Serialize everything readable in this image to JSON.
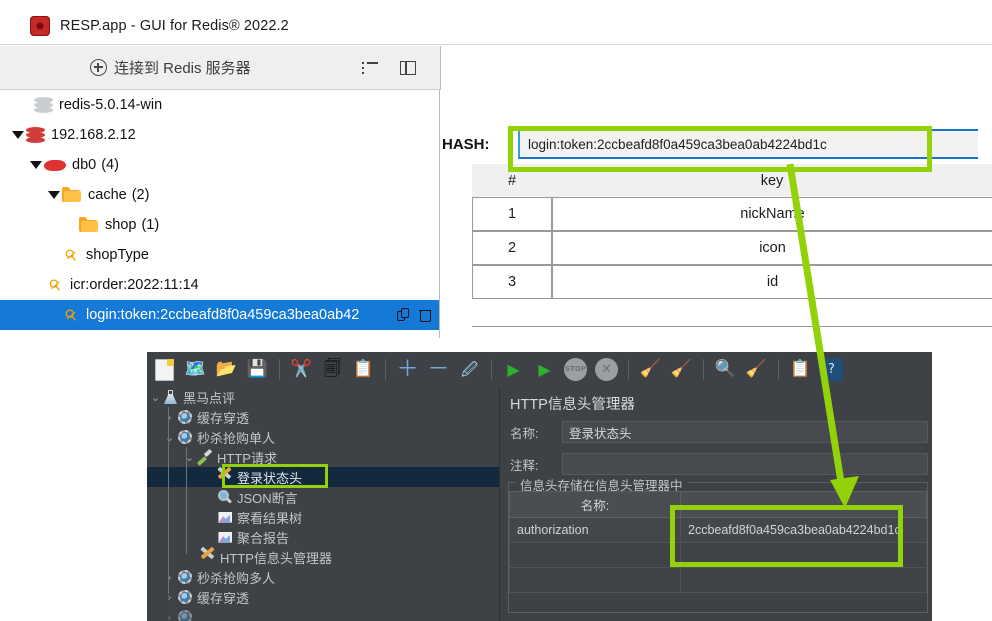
{
  "resp": {
    "title": "RESP.app - GUI for Redis® 2022.2",
    "logo_icon": "redis-hexagon-icon",
    "toolbar": {
      "connect_label": "连接到 Redis 服务器",
      "connect_icon": "plus-circle-icon",
      "list_icon": "list-view-icon",
      "panel_icon": "split-panel-icon"
    },
    "tree": [
      {
        "label": "redis-5.0.14-win",
        "icon": "stacked-disks-grey-icon",
        "indent": 0,
        "caret": "none",
        "count": "",
        "selected": false
      },
      {
        "label": "192.168.2.12",
        "icon": "stacked-disks-red-icon",
        "indent": 0,
        "caret": "down",
        "count": "",
        "selected": false
      },
      {
        "label": "db0",
        "icon": "database-diamond-icon",
        "indent": 1,
        "caret": "down",
        "count": "(4)",
        "selected": false
      },
      {
        "label": "cache",
        "icon": "folder-icon",
        "indent": 2,
        "caret": "down",
        "count": "(2)",
        "selected": false
      },
      {
        "label": "shop",
        "icon": "folder-icon",
        "indent": 3,
        "caret": "none",
        "count": "(1)",
        "selected": false
      },
      {
        "label": "shopType",
        "icon": "key-icon",
        "indent": 3,
        "caret": "none",
        "count": "",
        "selected": false
      },
      {
        "label": "icr:order:2022:11:14",
        "icon": "key-icon",
        "indent": 2,
        "caret": "none",
        "count": "",
        "selected": false
      },
      {
        "label": "login:token:2ccbeafd8f0a459ca3bea0ab42",
        "icon": "key-icon",
        "indent": 3,
        "caret": "none",
        "count": "",
        "selected": true
      }
    ],
    "row_actions": {
      "copy_icon": "copy-icon",
      "delete_icon": "trash-icon"
    },
    "detail": {
      "type_label": "HASH:",
      "key_value": "login:token:2ccbeafd8f0a459ca3bea0ab4224bd1c",
      "columns": [
        "#",
        "key"
      ],
      "rows": [
        {
          "index": "1",
          "key": "nickName"
        },
        {
          "index": "2",
          "key": "icon"
        },
        {
          "index": "3",
          "key": "id"
        }
      ]
    }
  },
  "jmeter": {
    "toolbar_icons": [
      "new-file-icon",
      "templates-icon",
      "open-folder-icon",
      "save-icon",
      "cut-icon",
      "copy-icon",
      "paste-icon",
      "expand-all-icon",
      "collapse-all-icon",
      "toggle-icon",
      "start-icon",
      "start-no-pauses-icon",
      "stop-icon",
      "shutdown-icon",
      "clear-icon",
      "clear-all-icon",
      "search-icon",
      "reset-search-icon",
      "function-helper-icon",
      "help-icon"
    ],
    "tree": [
      {
        "label": "黑马点评",
        "icon": "test-plan-flask-icon",
        "indent": 0,
        "caret": "down",
        "selected": false
      },
      {
        "label": "缓存穿透",
        "icon": "thread-group-gear-icon",
        "indent": 1,
        "caret": "right",
        "selected": false
      },
      {
        "label": "秒杀抢购单人",
        "icon": "thread-group-gear-icon",
        "indent": 1,
        "caret": "down",
        "selected": false
      },
      {
        "label": "HTTP请求",
        "icon": "http-request-pipette-icon",
        "indent": 2,
        "caret": "down",
        "selected": false
      },
      {
        "label": "登录状态头",
        "icon": "header-manager-tools-icon",
        "indent": 3,
        "caret": "none",
        "selected": true
      },
      {
        "label": "JSON断言",
        "icon": "assertion-magnifier-icon",
        "indent": 3,
        "caret": "none",
        "selected": false
      },
      {
        "label": "察看结果树",
        "icon": "listener-chart-icon",
        "indent": 3,
        "caret": "none",
        "selected": false
      },
      {
        "label": "聚合报告",
        "icon": "listener-chart-icon",
        "indent": 3,
        "caret": "none",
        "selected": false
      },
      {
        "label": "HTTP信息头管理器",
        "icon": "header-manager-tools-icon",
        "indent": 2,
        "caret": "none",
        "selected": false
      },
      {
        "label": "秒杀抢购多人",
        "icon": "thread-group-gear-icon",
        "indent": 1,
        "caret": "right",
        "selected": false
      },
      {
        "label": "缓存穿透",
        "icon": "thread-group-gear-icon",
        "indent": 1,
        "caret": "right",
        "selected": false
      }
    ],
    "panel": {
      "heading": "HTTP信息头管理器",
      "name_label": "名称:",
      "name_value": "登录状态头",
      "comment_label": "注释:",
      "comment_value": "",
      "group_legend": "信息头存储在信息头管理器中",
      "table_columns": [
        "名称:",
        ""
      ],
      "table_rows": [
        {
          "name": "authorization",
          "value": "2ccbeafd8f0a459ca3bea0ab4224bd1c"
        }
      ]
    }
  },
  "annotations": {
    "highlight_color": "#93d109",
    "arrow_name": "green-annotation-arrow",
    "boxes": [
      "hash-key-highlight",
      "jmeter-tree-node-highlight",
      "jmeter-header-value-highlight"
    ]
  }
}
